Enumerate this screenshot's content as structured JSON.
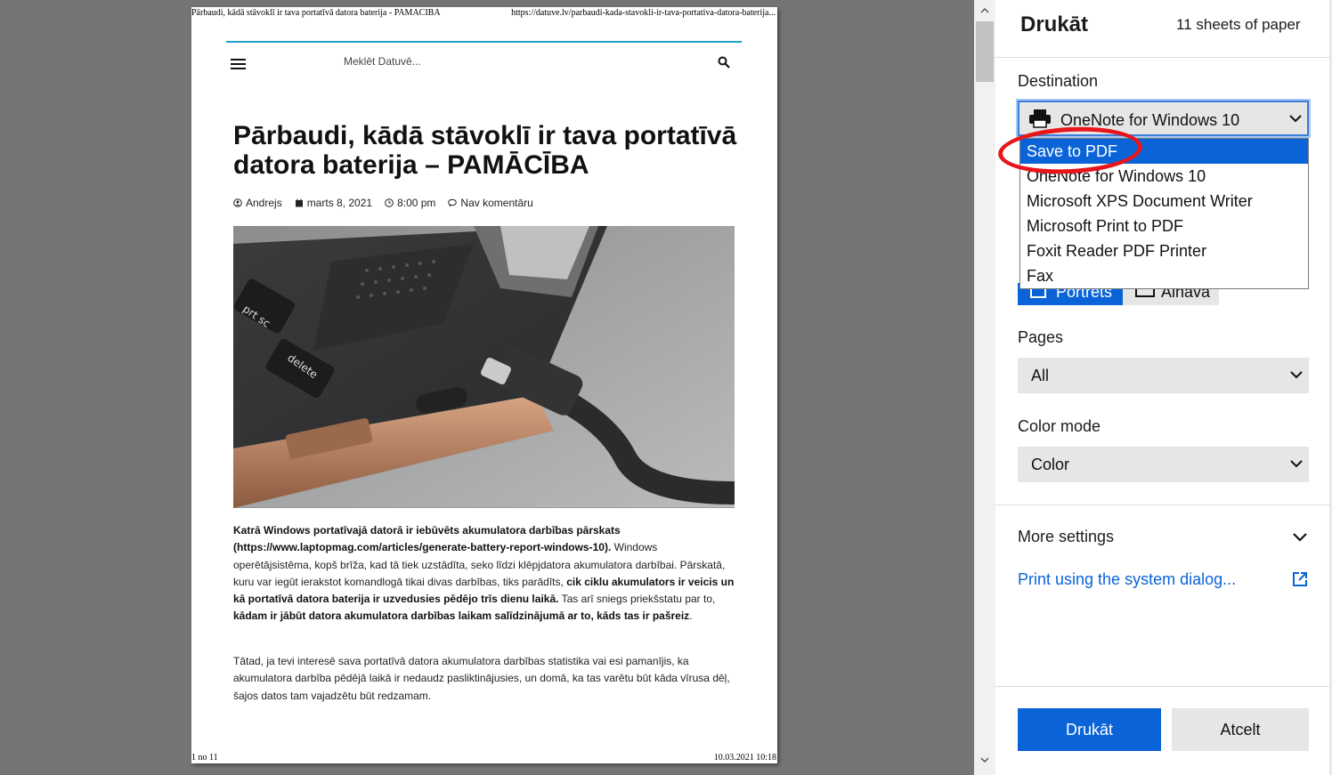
{
  "preview": {
    "header_left": "Pārbaudi, kādā stāvoklī ir tava portatīvā datora baterija - PAMACIBA",
    "header_right": "https://datuve.lv/parbaudi-kada-stavokli-ir-tava-portativa-datora-baterija...",
    "footer_left": "1 no 11",
    "footer_right": "10.03.2021 10:18",
    "site_search_placeholder": "Meklēt Datuvē...",
    "article_title": "Pārbaudi, kādā stāvoklī ir tava portatīvā datora baterija – PAMĀCĪBA",
    "meta": {
      "author": "Andrejs",
      "date": "marts 8, 2021",
      "time": "8:00 pm",
      "comments": "Nav komentāru"
    },
    "p1": {
      "b1": "Katrā Windows portatīvajā datorā ir iebūvēts akumulatora darbības pārskats (https://www.laptopmag.com/articles/generate-battery-report-windows-10).",
      "t1": " Windows operētājsistēma, kopš brīža, kad tā tiek uzstādīta, seko līdzi klēpjdatora akumulatora darbībai. Pārskatā, kuru var iegūt ierakstot komandlogā tikai divas darbības, tiks parādīts, ",
      "b2": "cik ciklu akumulators ir veicis un kā portatīvā datora baterija ir uzvedusies pēdējo trīs dienu laikā.",
      "t2": " Tas arī sniegs priekšstatu par to, ",
      "b3": "kādam ir jābūt datora akumulatora darbības laikam salīdzinājumā ar to, kāds tas ir pašreiz",
      "t3": "."
    },
    "p2": "Tātad, ja tevi interesē sava portatīvā datora akumulatora darbības statistika vai esi pamanījis, ka akumulatora darbība pēdējā laikā ir nedaudz pasliktinājusies, un domā, ka tas varētu būt kāda vīrusa dēļ, šajos datos tam vajadzētu būt redzamam."
  },
  "panel": {
    "title": "Drukāt",
    "sheets": "11 sheets of paper",
    "destination_label": "Destination",
    "destination_value": "OneNote for Windows 10",
    "destination_options": [
      "Save to PDF",
      "OneNote for Windows 10",
      "Microsoft XPS Document Writer",
      "Microsoft Print to PDF",
      "Foxit Reader PDF Printer",
      "Fax"
    ],
    "layout_portrait": "Portrets",
    "layout_landscape": "Ainava",
    "pages_label": "Pages",
    "pages_value": "All",
    "color_label": "Color mode",
    "color_value": "Color",
    "more_settings": "More settings",
    "system_dialog": "Print using the system dialog...",
    "print_button": "Drukāt",
    "cancel_button": "Atcelt"
  },
  "colors": {
    "accent": "#0a64d8",
    "annotation": "#e8151b",
    "site_line": "#1aa3c4"
  }
}
